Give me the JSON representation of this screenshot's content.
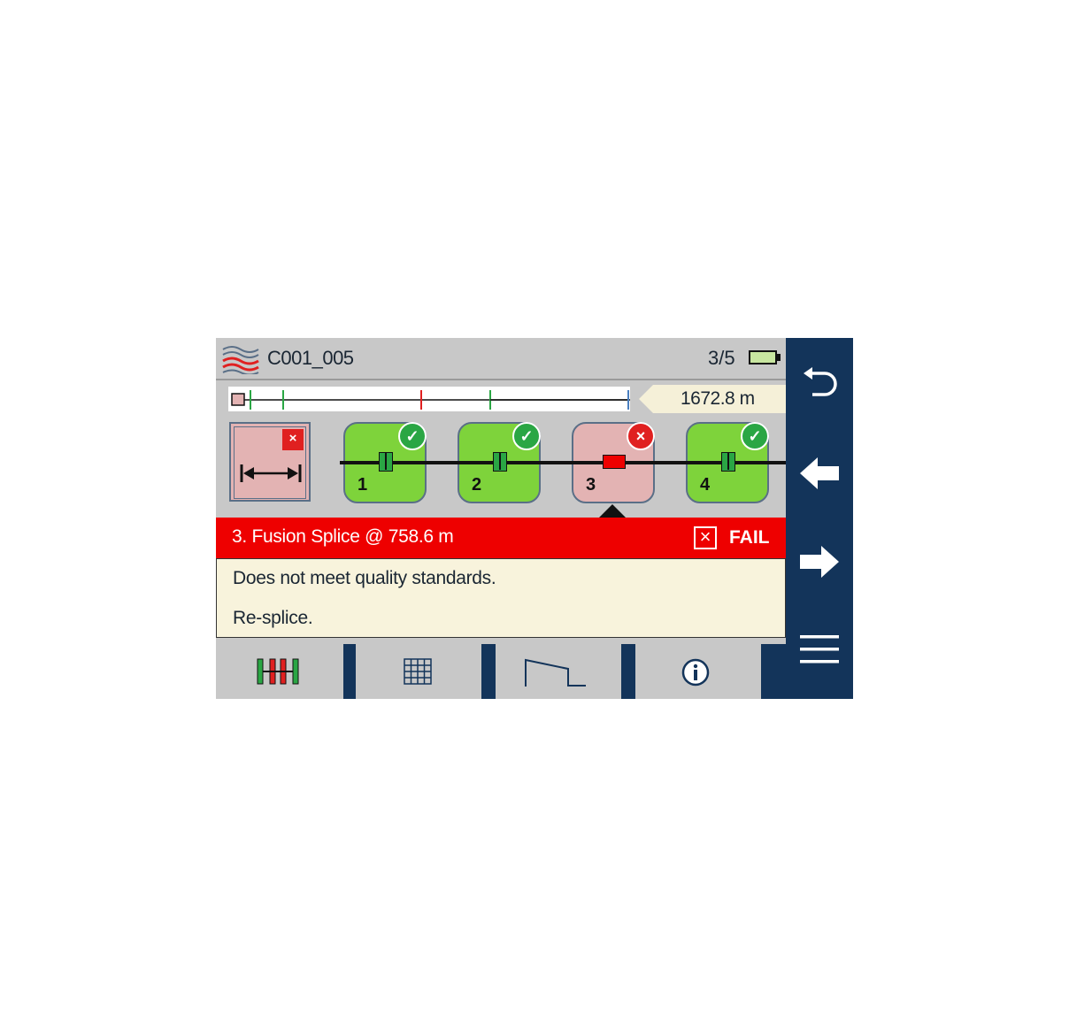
{
  "header": {
    "file_name": "C001_005",
    "count": "3/5",
    "app_icon": "fiber-waves-icon",
    "battery_icon": "battery-icon"
  },
  "trace": {
    "distance": "1672.8 m"
  },
  "events": [
    {
      "number": "1",
      "status": "pass"
    },
    {
      "number": "2",
      "status": "pass"
    },
    {
      "number": "3",
      "status": "fail"
    },
    {
      "number": "4",
      "status": "pass"
    }
  ],
  "detail": {
    "title": "3. Fusion Splice @ 758.6 m",
    "status_label": "FAIL",
    "message": "Does not meet quality standards.",
    "action": "Re-splice."
  },
  "tabs": [
    {
      "icon": "link-map-icon",
      "active": true
    },
    {
      "icon": "table-icon",
      "active": false
    },
    {
      "icon": "trace-icon",
      "active": false
    },
    {
      "icon": "info-icon",
      "active": false
    }
  ],
  "sidebar": [
    {
      "icon": "undo-icon"
    },
    {
      "icon": "arrow-left-icon"
    },
    {
      "icon": "arrow-right-icon"
    },
    {
      "icon": "menu-icon"
    }
  ],
  "colors": {
    "pass": "#7ed33b",
    "fail": "#ee0000",
    "fail_card": "#e3b3b3",
    "navy": "#13345a",
    "panel": "#c8c8c8",
    "cream": "#f8f3dc"
  }
}
